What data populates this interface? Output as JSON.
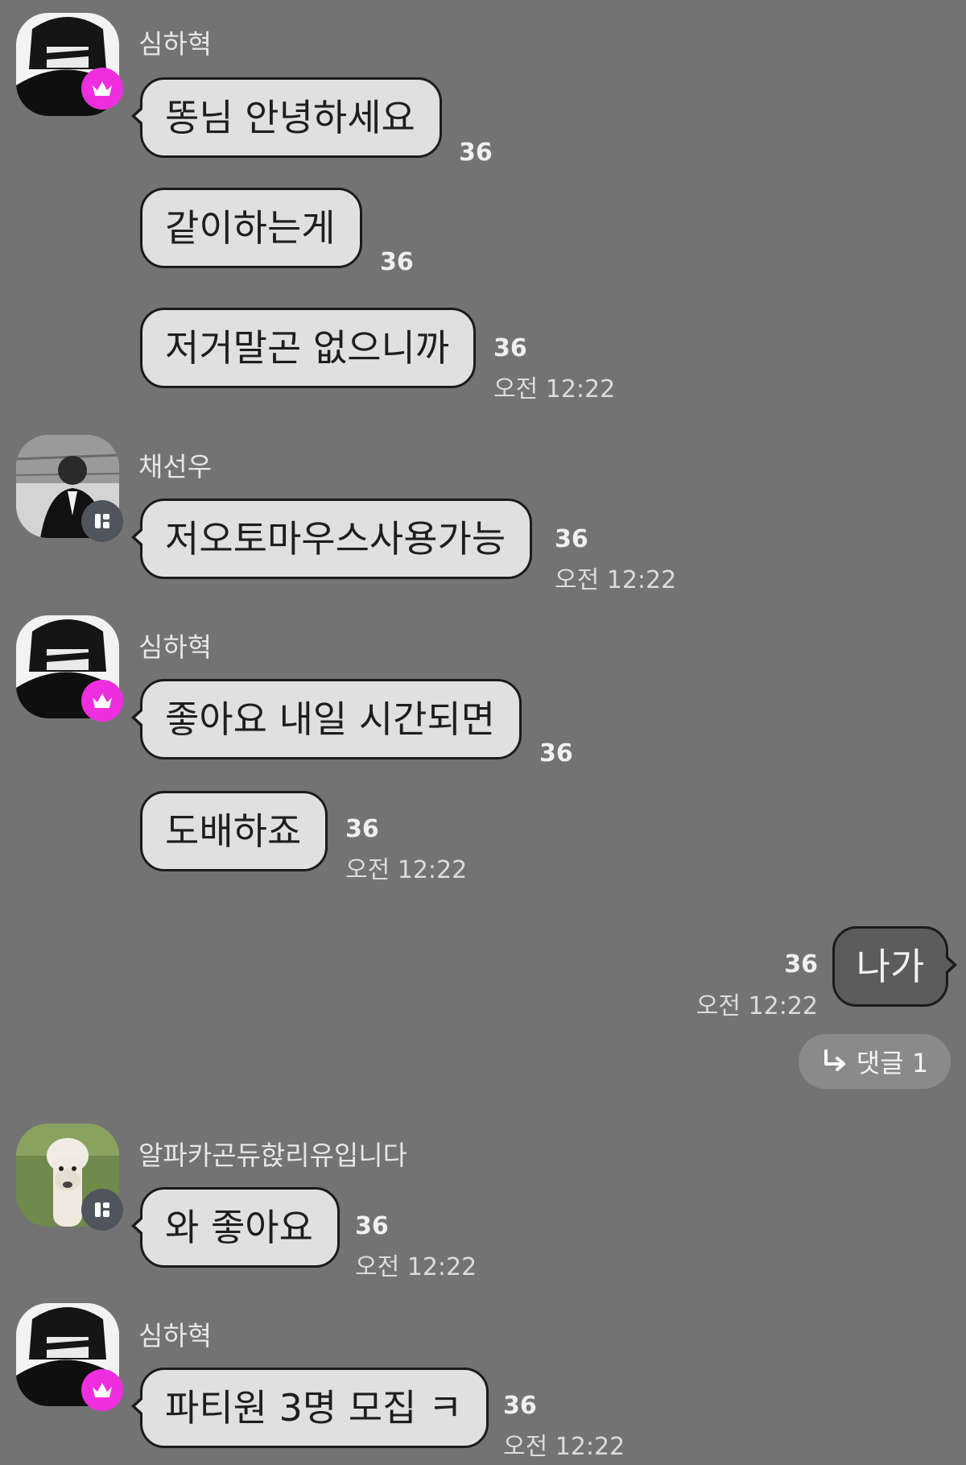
{
  "senders": {
    "simhahyeok": "심하혁",
    "chaeseonwoo": "채선우",
    "alpaca": "알파카곤듀핝리유입니다"
  },
  "messages": [
    {
      "text": "똥님 안녕하세요",
      "count": "36"
    },
    {
      "text": "같이하는게",
      "count": "36"
    },
    {
      "text": "저거말곤 없으니까",
      "count": "36",
      "time": "오전 12:22"
    },
    {
      "text": "저오토마우스사용가능",
      "count": "36",
      "time": "오전 12:22"
    },
    {
      "text": "좋아요 내일 시간되면",
      "count": "36"
    },
    {
      "text": "도배하죠",
      "count": "36",
      "time": "오전 12:22"
    },
    {
      "text": "나가",
      "count": "36",
      "time": "오전 12:22"
    },
    {
      "text": "와 좋아요",
      "count": "36",
      "time": "오전 12:22"
    },
    {
      "text": "파티원 3명 모집 ㅋ",
      "count": "36",
      "time": "오전 12:22"
    }
  ],
  "reply_button": {
    "label": "댓글 1",
    "icon": "reply-arrow-icon"
  },
  "icons": {
    "owner_badge": "crown-icon",
    "member_badge": "member-badge-icon"
  },
  "colors": {
    "background": "#737373",
    "bubble": "#e0e0e0",
    "my_bubble": "#5c5c5c",
    "crown_badge": "#ef2ee0"
  }
}
